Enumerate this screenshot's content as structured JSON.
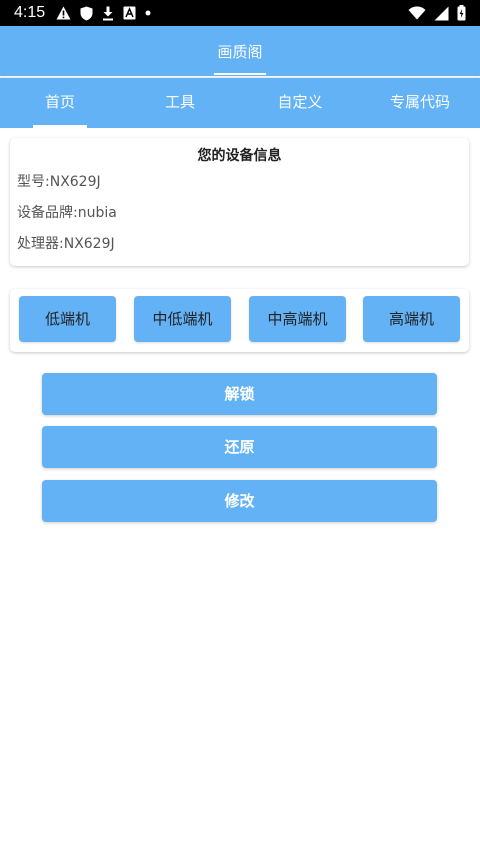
{
  "status_bar": {
    "time": "4:15",
    "left_icons": [
      "warning-icon",
      "shield-icon",
      "download-icon",
      "font-icon",
      "dot-icon"
    ],
    "right_icons": [
      "wifi-icon",
      "signal-icon",
      "battery-icon"
    ]
  },
  "app": {
    "title": "画质阁"
  },
  "tabs": [
    {
      "label": "首页",
      "selected": true
    },
    {
      "label": "工具",
      "selected": false
    },
    {
      "label": "自定义",
      "selected": false
    },
    {
      "label": "专属代码",
      "selected": false
    }
  ],
  "device_info": {
    "title": "您的设备信息",
    "lines": [
      "型号:NX629J",
      "设备品牌:nubia",
      "处理器:NX629J"
    ]
  },
  "levels": [
    "低端机",
    "中低端机",
    "中高端机",
    "高端机"
  ],
  "actions": [
    "解锁",
    "还原",
    "修改"
  ],
  "colors": {
    "accent": "#62b2f5",
    "status_bar": "#000000"
  }
}
